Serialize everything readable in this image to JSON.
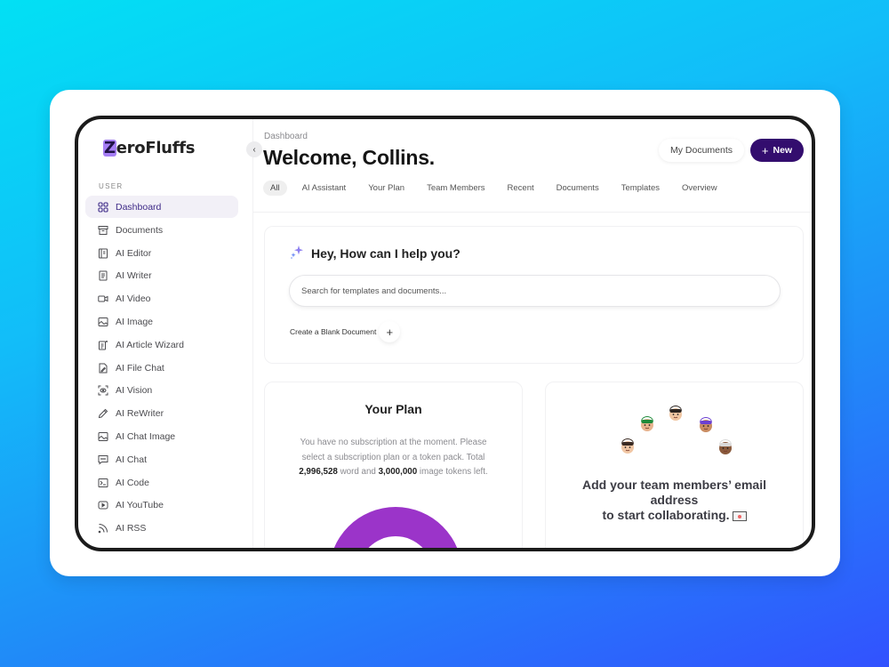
{
  "app": {
    "logo_initial": "Z",
    "logo_rest": "eroFluffs",
    "brand_color": "#330d6e",
    "accent_color": "#9b34c9"
  },
  "sidebar": {
    "section_label": "USER",
    "items": [
      {
        "label": "Dashboard",
        "icon": "grid-icon",
        "active": true
      },
      {
        "label": "Documents",
        "icon": "archive-icon"
      },
      {
        "label": "AI Editor",
        "icon": "notebook-icon"
      },
      {
        "label": "AI Writer",
        "icon": "document-icon"
      },
      {
        "label": "AI Video",
        "icon": "video-icon"
      },
      {
        "label": "AI Image",
        "icon": "image-icon"
      },
      {
        "label": "AI Article Wizard",
        "icon": "wizard-icon"
      },
      {
        "label": "AI File Chat",
        "icon": "file-edit-icon"
      },
      {
        "label": "AI Vision",
        "icon": "eye-scan-icon"
      },
      {
        "label": "AI ReWriter",
        "icon": "pencil-icon"
      },
      {
        "label": "AI Chat Image",
        "icon": "image-icon"
      },
      {
        "label": "AI Chat",
        "icon": "chat-icon"
      },
      {
        "label": "AI Code",
        "icon": "terminal-icon"
      },
      {
        "label": "AI YouTube",
        "icon": "play-icon"
      },
      {
        "label": "AI RSS",
        "icon": "rss-icon"
      }
    ]
  },
  "header": {
    "breadcrumb": "Dashboard",
    "title": "Welcome, Collins.",
    "my_documents_label": "My Documents",
    "new_label": "New",
    "tabs": [
      {
        "label": "All",
        "active": true
      },
      {
        "label": "AI Assistant"
      },
      {
        "label": "Your Plan"
      },
      {
        "label": "Team Members"
      },
      {
        "label": "Recent"
      },
      {
        "label": "Documents"
      },
      {
        "label": "Templates"
      },
      {
        "label": "Overview"
      }
    ]
  },
  "help": {
    "title": "Hey, How can I help you?",
    "search_placeholder": "Search for templates and documents...",
    "blank_doc_label": "Create a Blank Document"
  },
  "plan": {
    "title": "Your Plan",
    "text_1": "You have no subscription at the moment. Please select a subscription plan or a token pack. Total ",
    "word_tokens": "2,996,528",
    "text_2": " word and ",
    "image_tokens": "3,000,000",
    "text_3": " image tokens left.",
    "gauge_color": "#9b34c9"
  },
  "team": {
    "line_1": "Add your team members’ email",
    "line_2": "address",
    "line_3": "to start collaborating.",
    "avatars": [
      {
        "name": "member-1",
        "hair": "#3a2a22",
        "skin": "#f1c7a5"
      },
      {
        "name": "member-2",
        "hair": "#1f8a3a",
        "skin": "#e8b48f"
      },
      {
        "name": "member-3",
        "hair": "#2b2420",
        "skin": "#f0c6a2"
      },
      {
        "name": "member-4",
        "hair": "#6b3fd0",
        "skin": "#c98c62"
      },
      {
        "name": "member-5",
        "hair": "#d9d9d9",
        "skin": "#8a5a3c"
      }
    ]
  }
}
